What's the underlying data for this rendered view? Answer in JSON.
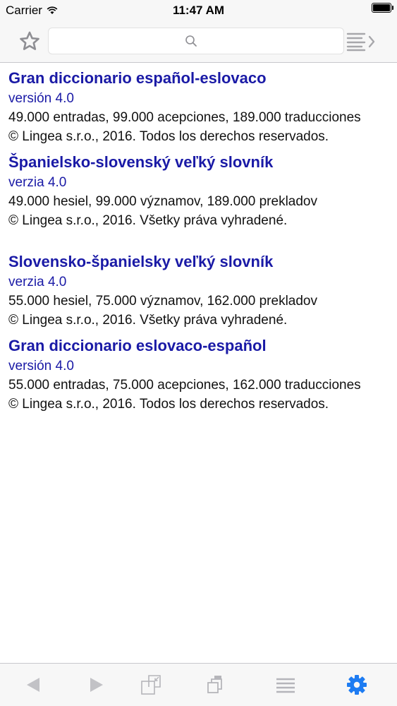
{
  "status_bar": {
    "carrier": "Carrier",
    "time": "11:47 AM",
    "battery_level": 1.0
  },
  "toolbar": {
    "favorite_icon": "star-icon",
    "search": {
      "placeholder": "",
      "value": "",
      "icon": "search-icon"
    },
    "list_icon": "list-forward-icon"
  },
  "dictionaries": [
    {
      "title": "Gran diccionario español-eslovaco",
      "version": "versión 4.0",
      "stats": "49.000 entradas, 99.000 acepciones, 189.000 traducciones",
      "copyright": "© Lingea s.r.o., 2016. Todos los derechos reservados."
    },
    {
      "title": "Španielsko-slovenský veľký slovník",
      "version": "verzia 4.0",
      "stats": "49.000 hesiel, 99.000 významov, 189.000 prekladov",
      "copyright": "© Lingea s.r.o., 2016. Všetky práva vyhradené."
    },
    {
      "title": "Slovensko-španielsky veľký slovník",
      "version": "verzia 4.0",
      "stats": "55.000 hesiel, 75.000 významov, 162.000 prekladov",
      "copyright": "© Lingea s.r.o., 2016. Všetky práva vyhradené."
    },
    {
      "title": "Gran diccionario eslovaco-español",
      "version": "versión 4.0",
      "stats": "55.000 entradas, 75.000 acepciones, 162.000 traducciones",
      "copyright": "© Lingea s.r.o., 2016. Todos los derechos reservados."
    }
  ],
  "bottom_bar": {
    "icons": [
      "back-icon",
      "forward-icon",
      "collapse-icon",
      "windows-icon",
      "menu-icon",
      "settings-icon"
    ],
    "active": "settings-icon"
  },
  "colors": {
    "link_blue": "#1a1aa6",
    "icon_gray": "#a7a7ab",
    "active_blue": "#1e7cf2",
    "bar_bg": "#f7f7f7"
  }
}
